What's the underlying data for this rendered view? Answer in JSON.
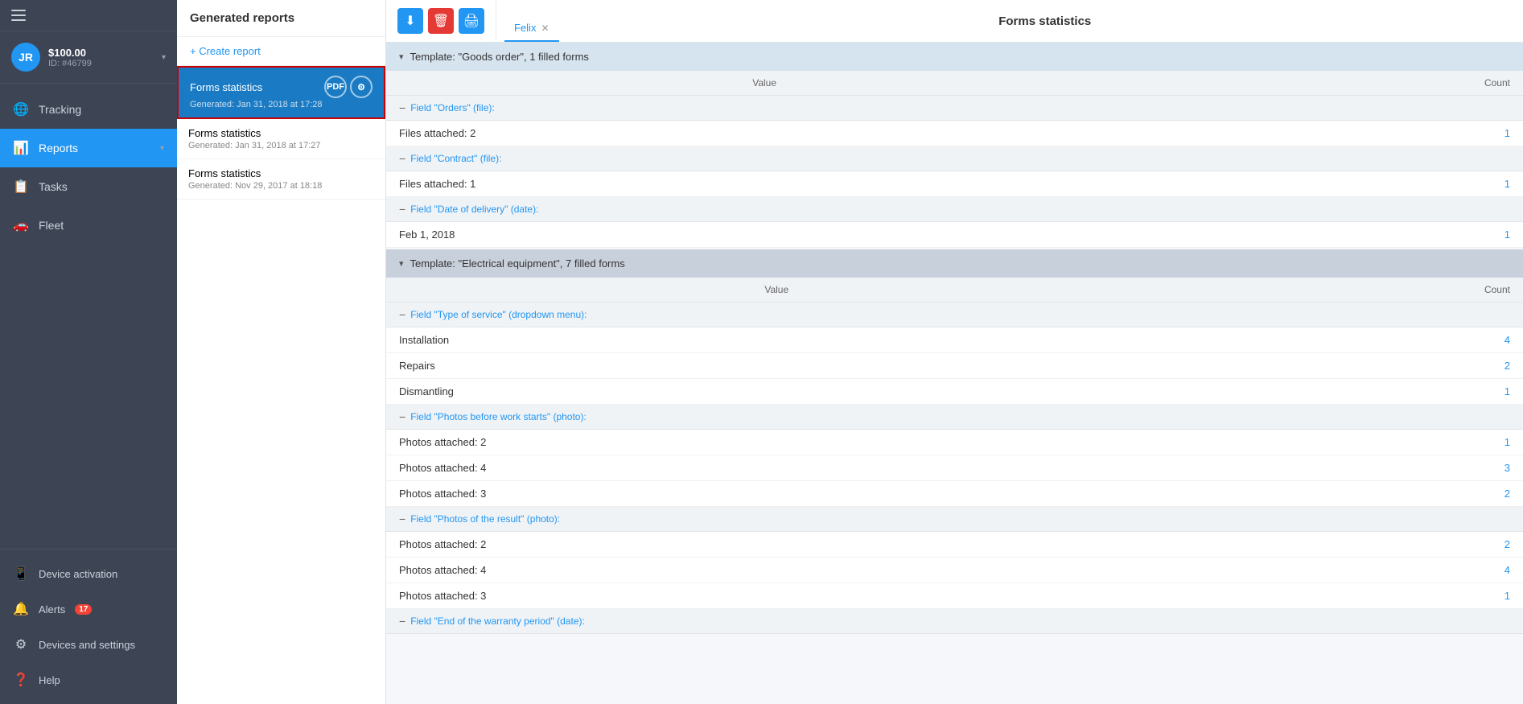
{
  "sidebar": {
    "hamburger": "☰",
    "user": {
      "initials": "JR",
      "balance": "$100.00",
      "id": "ID: #46799"
    },
    "nav_items": [
      {
        "id": "tracking",
        "label": "Tracking",
        "icon": "🌐"
      },
      {
        "id": "reports",
        "label": "Reports",
        "icon": "📊",
        "active": true,
        "arrow": "▾"
      },
      {
        "id": "tasks",
        "label": "Tasks",
        "icon": "📋"
      },
      {
        "id": "fleet",
        "label": "Fleet",
        "icon": "🚗"
      }
    ],
    "bottom_items": [
      {
        "id": "device-activation",
        "label": "Device activation",
        "icon": "📱"
      },
      {
        "id": "alerts",
        "label": "Alerts",
        "icon": "🔔",
        "badge": "17"
      },
      {
        "id": "devices-settings",
        "label": "Devices and settings",
        "icon": "⚙"
      },
      {
        "id": "help",
        "label": "Help",
        "icon": "❓"
      }
    ]
  },
  "reports_panel": {
    "title": "Generated reports",
    "create_btn": "+ Create report",
    "reports": [
      {
        "id": 1,
        "title": "Forms statistics",
        "date": "Generated: Jan 31, 2018 at 17:28",
        "selected": true,
        "actions": [
          "PDF",
          "⚙"
        ]
      },
      {
        "id": 2,
        "title": "Forms statistics",
        "date": "Generated: Jan 31, 2018 at 17:27",
        "selected": false
      },
      {
        "id": 3,
        "title": "Forms statistics",
        "date": "Generated: Nov 29, 2017 at 18:18",
        "selected": false
      }
    ]
  },
  "toolbar": {
    "download_icon": "⬇",
    "delete_icon": "🗑",
    "print_icon": "🖨"
  },
  "stats": {
    "title": "Forms statistics",
    "tab_label": "Felix",
    "templates": [
      {
        "id": "goods-order",
        "header": "Template: \"Goods order\", 1 filled forms",
        "color": "blue",
        "col_value": "Value",
        "col_count": "Count",
        "fields": [
          {
            "label": "Field \"Orders\" (file):",
            "rows": [
              {
                "value": "Files attached: 2",
                "count": "1"
              }
            ]
          },
          {
            "label": "Field \"Contract\" (file):",
            "rows": [
              {
                "value": "Files attached: 1",
                "count": "1"
              }
            ]
          },
          {
            "label": "Field \"Date of delivery\" (date):",
            "rows": [
              {
                "value": "Feb 1, 2018",
                "count": "1"
              }
            ]
          }
        ]
      },
      {
        "id": "electrical-equipment",
        "header": "Template: \"Electrical equipment\", 7 filled forms",
        "color": "gray",
        "col_value": "Value",
        "col_count": "Count",
        "fields": [
          {
            "label": "Field \"Type of service\" (dropdown menu):",
            "rows": [
              {
                "value": "Installation",
                "count": "4"
              },
              {
                "value": "Repairs",
                "count": "2"
              },
              {
                "value": "Dismantling",
                "count": "1"
              }
            ]
          },
          {
            "label": "Field \"Photos before work starts\" (photo):",
            "rows": [
              {
                "value": "Photos attached: 2",
                "count": "1"
              },
              {
                "value": "Photos attached: 4",
                "count": "3"
              },
              {
                "value": "Photos attached: 3",
                "count": "2"
              }
            ]
          },
          {
            "label": "Field \"Photos of the result\" (photo):",
            "rows": [
              {
                "value": "Photos attached: 2",
                "count": "2"
              },
              {
                "value": "Photos attached: 4",
                "count": "4"
              },
              {
                "value": "Photos attached: 3",
                "count": "1"
              }
            ]
          },
          {
            "label": "Field \"End of the warranty period\" (date):",
            "rows": []
          }
        ]
      }
    ]
  }
}
